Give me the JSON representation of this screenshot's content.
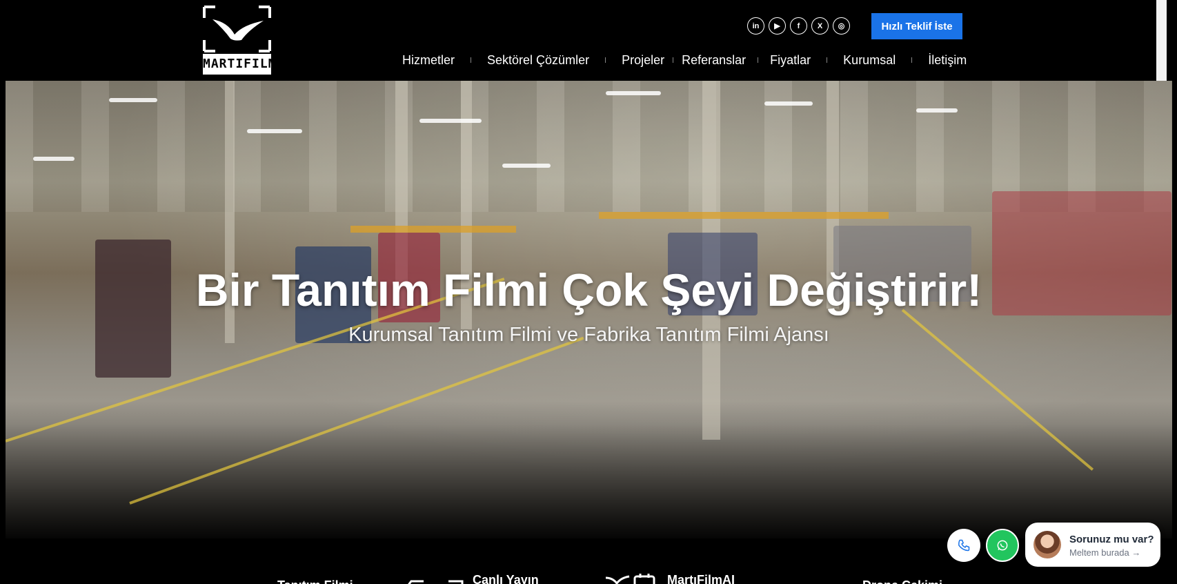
{
  "brand": {
    "logo_text": "MARTIFILM"
  },
  "header": {
    "quote_button": "Hızlı Teklif İste",
    "socials": [
      {
        "icon": "linkedin-icon",
        "glyph": "in"
      },
      {
        "icon": "youtube-icon",
        "glyph": "▶"
      },
      {
        "icon": "facebook-icon",
        "glyph": "f"
      },
      {
        "icon": "x-icon",
        "glyph": "X"
      },
      {
        "icon": "instagram-icon",
        "glyph": "◎"
      }
    ]
  },
  "nav": {
    "items": [
      "Hizmetler",
      "Sektörel Çözümler",
      "Projeler",
      "Referanslar",
      "Fiyatlar",
      "Kurumsal",
      "İletişim"
    ]
  },
  "hero": {
    "title": "Bir Tanıtım Filmi Çok Şeyi Değiştirir!",
    "subtitle": "Kurumsal Tanıtım Filmi ve Fabrika Tanıtım Filmi Ajansı"
  },
  "features": {
    "items": [
      "Tanıtım Filmi",
      "Canlı Yayın",
      "MartıFilmAI",
      "Drone Çekimi"
    ]
  },
  "contact": {
    "chat_title": "Sorunuz mu var?",
    "chat_subtitle": "Meltem burada →"
  },
  "colors": {
    "accent": "#1a73e8",
    "whatsapp": "#22c55e",
    "header_bg": "#000000"
  }
}
